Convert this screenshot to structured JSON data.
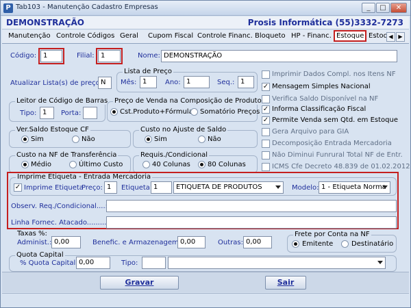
{
  "window": {
    "title": "Tab103 - Manutenção Cadastro Empresas",
    "app_icon": "P",
    "minimize": "_",
    "maximize": "□",
    "close": "✕"
  },
  "header": {
    "company": "DEMONSTRAÇÃO",
    "vendor": "Prosis Informática (55)3332-7273"
  },
  "tabs": [
    "Manutenção",
    "Controle Códigos",
    "Geral",
    "Cupom Fiscal",
    "Controle Financ.",
    "Bloqueto",
    "HP - Financ.",
    "Estoque",
    "Estoq"
  ],
  "tab_arrows": {
    "left": "◀",
    "right": "▶"
  },
  "codigo": {
    "label": "Código:",
    "value": "1"
  },
  "filial": {
    "label": "Filial:",
    "value": "1"
  },
  "nome": {
    "label": "Nome:",
    "value": "DEMONSTRAÇÃO"
  },
  "atualizar": {
    "label": "Atualizar Lista(s) de preço:",
    "value": "N"
  },
  "lista_preco": {
    "title": "Lista de Preço",
    "mes_label": "Mês:",
    "mes": "1",
    "ano_label": "Ano:",
    "ano": "1",
    "seq_label": "Seq.:",
    "seq": "1"
  },
  "leitor": {
    "title": "Leitor de Código de Barras",
    "tipo_label": "Tipo:",
    "tipo": "1",
    "porta_label": "Porta:",
    "porta": ""
  },
  "preco_venda": {
    "title": "Preço de Venda na Composição de Produtos",
    "opt1": "Cst.Produto+Fórmula",
    "opt2": "Somatório Preços"
  },
  "ver_saldo": {
    "title": "Ver.Saldo Estoque CF",
    "opt1": "Sim",
    "opt2": "Não"
  },
  "custo_ajuste": {
    "title": "Custo no Ajuste de Saldo",
    "opt1": "Sim",
    "opt2": "Não"
  },
  "custo_nf": {
    "title": "Custo na NF de Transferência",
    "opt1": "Médio",
    "opt2": "Último Custo"
  },
  "requis": {
    "title": "Requis./Condicional",
    "opt1": "40 Colunas",
    "opt2": "80 Colunas"
  },
  "checkboxes": [
    {
      "label": "Imprimir Dados Compl. nos Itens NF",
      "checked": false
    },
    {
      "label": "Mensagem Simples Nacional",
      "checked": true
    },
    {
      "label": "Verifica Saldo Disponível na NF",
      "checked": false
    },
    {
      "label": "Informa Classificação Fiscal",
      "checked": true
    },
    {
      "label": "Permite Venda sem Qtd. em Estoque",
      "checked": true
    },
    {
      "label": "Gera Arquivo para GIA",
      "checked": false
    },
    {
      "label": "Decomposição Entrada Mercadoria",
      "checked": false
    },
    {
      "label": "Não Diminui Funrural Total NF de Entr.",
      "checked": false
    },
    {
      "label": "ICMS Cfe Decreto 48.839 de 01.02.2012",
      "checked": false
    }
  ],
  "etiqueta": {
    "title": "Imprime Etiqueta - Entrada Mercadoria",
    "chk_label": "Imprime Etiqueta",
    "preco_label": "Preço:",
    "preco": "1",
    "etq_label": "Etiqueta:",
    "etq_num": "1",
    "etq_select": "ETIQUETA DE PRODUTOS",
    "modelo_label": "Modelo:",
    "modelo": "1 - Etiqueta Norma",
    "observ_label": "Observ. Req./Condicional....:",
    "observ": "",
    "linha_label": "Linha Fornec. Atacado.........:",
    "linha": ""
  },
  "taxas": {
    "title": "Taxas %:",
    "adm_label": "Administ.:",
    "adm": "0,00",
    "benef_label": "Benefic. e Armazenagem:",
    "benef": "0,00",
    "outras_label": "Outras:",
    "outras": "0,00"
  },
  "frete": {
    "title": "Frete por Conta na NF",
    "opt1": "Emitente",
    "opt2": "Destinatário"
  },
  "quota": {
    "title": "Quota Capital",
    "pct_label": "% Quota Capital:",
    "pct": "0,00",
    "tipo_label": "Tipo:",
    "tipo": "",
    "tipo_desc": ""
  },
  "buttons": {
    "gravar": "Gravar",
    "sair": "Sair"
  }
}
